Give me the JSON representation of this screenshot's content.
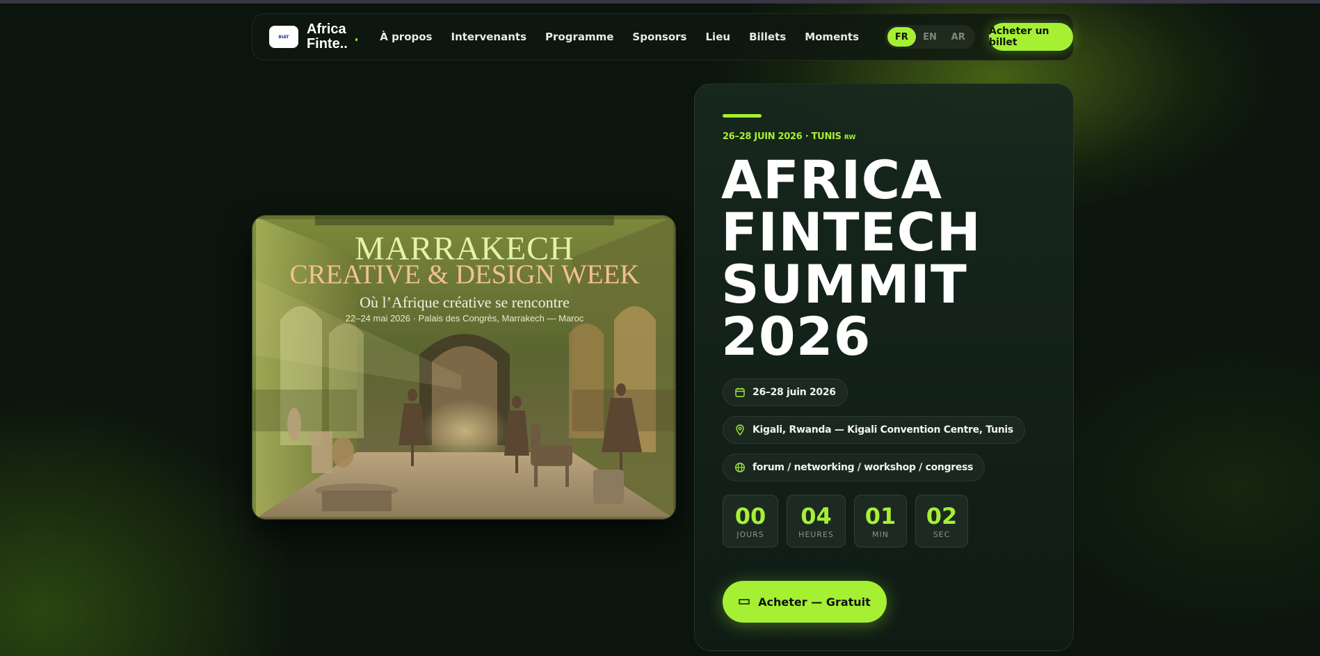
{
  "nav": {
    "brand": "Africa Finte...",
    "logo_text": "BIAT",
    "links": [
      "À propos",
      "Intervenants",
      "Programme",
      "Sponsors",
      "Lieu",
      "Billets",
      "Moments"
    ],
    "languages": [
      "FR",
      "EN",
      "AR"
    ],
    "active_language": "FR",
    "cta": "Acheter un billet"
  },
  "hero_image": {
    "title": "MARRAKECH",
    "subtitle": "CREATIVE & DESIGN WEEK",
    "tagline": "Où l’Afrique créative se rencontre",
    "info": "22–24 mai 2026 · Palais des Congrès, Marrakech — Maroc"
  },
  "event": {
    "kicker": "26–28 JUIN 2026 · TUNIS",
    "kicker_code": "RW",
    "headline": [
      "AFRICA",
      "FINTECH",
      "SUMMIT",
      "2026"
    ],
    "date": "26–28 juin 2026",
    "location": "Kigali, Rwanda — Kigali Convention Centre, Tunis",
    "formats": "forum / networking / workshop / congress",
    "countdown": [
      {
        "value": "00",
        "label": "JOURS"
      },
      {
        "value": "04",
        "label": "HEURES"
      },
      {
        "value": "01",
        "label": "MIN"
      },
      {
        "value": "02",
        "label": "SEC"
      }
    ],
    "cta": "Acheter — Gratuit"
  },
  "colors": {
    "accent": "#a6f033",
    "background": "#0b140d"
  },
  "icons": {
    "date": "calendar-icon",
    "location": "map-pin-icon",
    "formats": "globe-icon",
    "ticket": "ticket-icon"
  }
}
